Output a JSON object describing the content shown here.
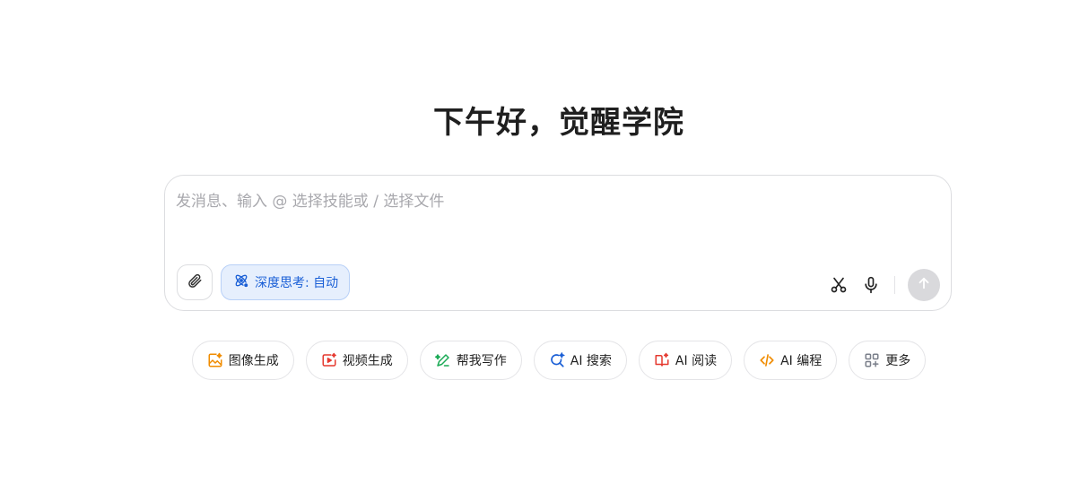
{
  "greeting": "下午好，觉醒学院",
  "composer": {
    "placeholder": "发消息、输入 @ 选择技能或 / 选择文件",
    "value": "",
    "attach_icon": "paperclip-icon",
    "deep_think_label": "深度思考: 自动",
    "deep_think_icon": "atom-icon",
    "scissors_icon": "scissors-icon",
    "mic_icon": "microphone-icon",
    "send_icon": "arrow-up-icon"
  },
  "chips": [
    {
      "label": "图像生成",
      "icon": "image-gen-icon",
      "color": "#f08c00"
    },
    {
      "label": "视频生成",
      "icon": "video-gen-icon",
      "color": "#e5392f"
    },
    {
      "label": "帮我写作",
      "icon": "pen-icon",
      "color": "#1aaa55"
    },
    {
      "label": "AI 搜索",
      "icon": "search-sparkle-icon",
      "color": "#1a5fd6"
    },
    {
      "label": "AI 阅读",
      "icon": "book-sparkle-icon",
      "color": "#e5392f"
    },
    {
      "label": "AI 编程",
      "icon": "code-icon",
      "color": "#f08c00"
    },
    {
      "label": "更多",
      "icon": "grid-plus-icon",
      "color": "#7a7f8a"
    }
  ],
  "colors": {
    "accent": "#1a5fd6",
    "deep_think_bg": "#e6effd",
    "send_disabled": "#d9d9dc"
  }
}
